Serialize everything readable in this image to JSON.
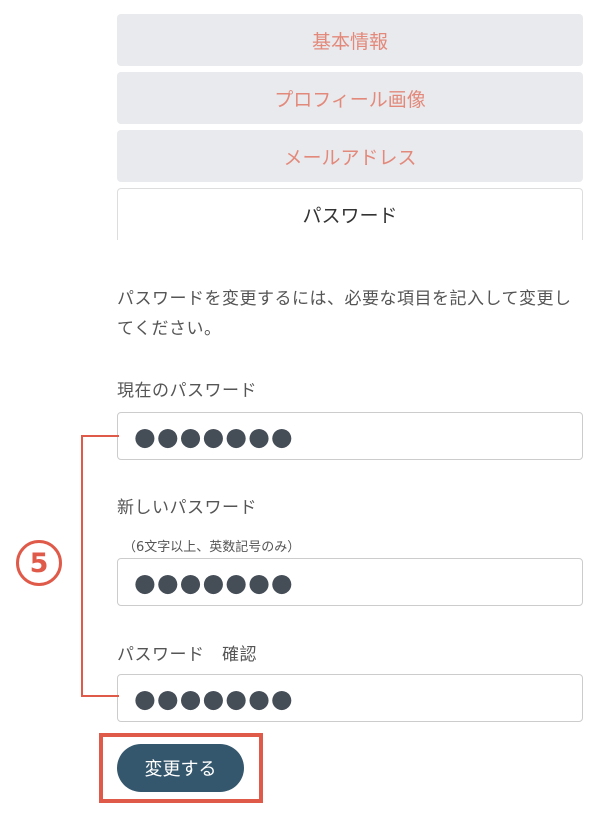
{
  "tabs": [
    {
      "label": "基本情報",
      "active": false
    },
    {
      "label": "プロフィール画像",
      "active": false
    },
    {
      "label": "メールアドレス",
      "active": false
    },
    {
      "label": "パスワード",
      "active": true
    }
  ],
  "intro": "パスワードを変更するには、必要な項目を記入して変更してください。",
  "fields": {
    "current": {
      "label": "現在のパスワード",
      "value": "●●●●●●●"
    },
    "new": {
      "label": "新しいパスワード",
      "note": "（6文字以上、英数記号のみ）",
      "value": "●●●●●●●"
    },
    "confirm": {
      "label": "パスワード　確認",
      "value": "●●●●●●●"
    }
  },
  "annotation": {
    "step": "5",
    "color": "#e05a4a"
  },
  "submit_label": "変更する",
  "colors": {
    "tab_text": "#e3897b",
    "tab_bg": "#e9eaed",
    "button_bg": "#34576d"
  }
}
